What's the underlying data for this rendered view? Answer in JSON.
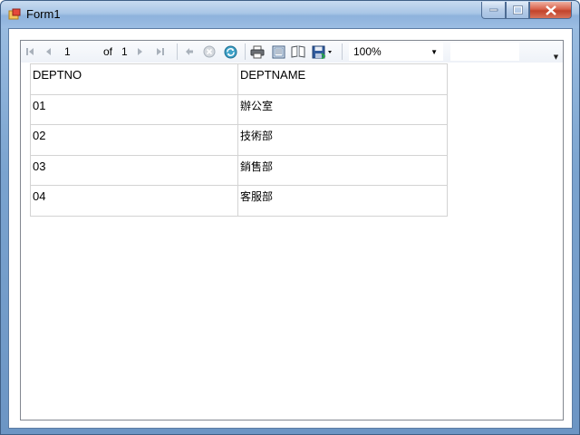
{
  "window": {
    "title": "Form1"
  },
  "toolbar": {
    "current_page": "1",
    "of_label": "of",
    "total_pages": "1",
    "zoom": "100%",
    "find_text": ""
  },
  "report": {
    "headers": [
      "DEPTNO",
      "DEPTNAME"
    ],
    "rows": [
      [
        "01",
        "辦公室"
      ],
      [
        "02",
        "技術部"
      ],
      [
        "03",
        "銷售部"
      ],
      [
        "04",
        "客服部"
      ]
    ]
  },
  "icons": {
    "first": "first-page-icon",
    "prev": "previous-page-icon",
    "next": "next-page-icon",
    "last": "last-page-icon",
    "back": "back-to-parent-icon",
    "stop": "stop-icon",
    "refresh": "refresh-icon",
    "print": "print-icon",
    "print_layout": "print-layout-icon",
    "page_setup": "page-setup-icon",
    "export": "export-save-icon"
  }
}
